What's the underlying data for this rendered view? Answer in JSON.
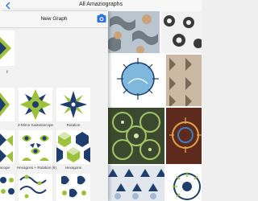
{
  "status_bar": {
    "title": "All Amaziographs"
  },
  "popover": {
    "title": "New Graph",
    "templates": [
      {
        "label": "y"
      },
      {
        "label": "2-Mirror Kaleidoscope"
      },
      {
        "label": "Rotation"
      },
      {
        "label": "scope"
      },
      {
        "label": "Hexagons + Rotation (6)"
      },
      {
        "label": "Hexagons"
      },
      {
        "label": ""
      },
      {
        "label": ""
      },
      {
        "label": ""
      }
    ]
  },
  "colors": {
    "navy": "#1f3e6e",
    "lime": "#9dc13a",
    "olive": "#8c8c3c",
    "sky": "#7fb7dd",
    "panel": "#f2f2f2"
  },
  "icons": {
    "camera": "camera-icon",
    "back": "chevron-left-icon"
  }
}
